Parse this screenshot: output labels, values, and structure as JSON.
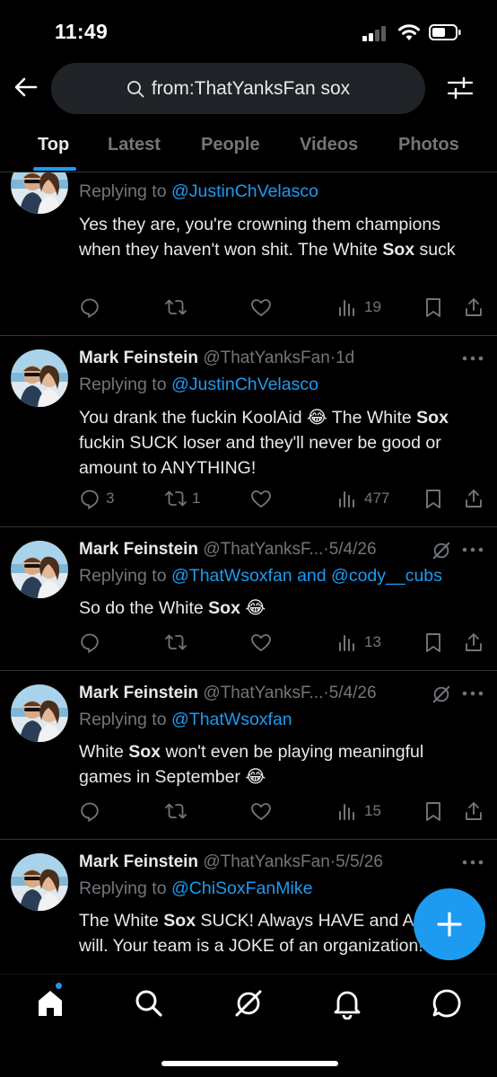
{
  "status": {
    "time": "11:49"
  },
  "search": {
    "query": "from:ThatYanksFan sox"
  },
  "tabs": [
    {
      "label": "Top",
      "active": true
    },
    {
      "label": "Latest"
    },
    {
      "label": "People"
    },
    {
      "label": "Videos"
    },
    {
      "label": "Photos"
    }
  ],
  "tweets": [
    {
      "replying_prefix": "Replying to ",
      "replying_to": "@JustinChVelasco",
      "body_parts": [
        "Yes they are, you're crowning them champions when they haven't won shit. The White ",
        "Sox",
        " suck"
      ],
      "replies": "",
      "reposts": "",
      "views": "19"
    },
    {
      "name": "Mark Feinstein",
      "handle": "@ThatYanksFan",
      "time": "·1d",
      "replying_prefix": "Replying to ",
      "replying_to": "@JustinChVelasco",
      "body_parts": [
        "You drank the fuckin KoolAid 😂 The White ",
        "Sox",
        " fuckin SUCK loser and they'll never be good or amount to ANYTHING!"
      ],
      "replies": "3",
      "reposts": "1",
      "views": "477"
    },
    {
      "name": "Mark Feinstein",
      "handle": "@ThatYanksF...",
      "time": "·5/4/26",
      "replying_prefix": "Replying to ",
      "replying_to": "@ThatWsoxfan and @cody__cubs",
      "body_parts": [
        "So do the White ",
        "Sox",
        " 😂"
      ],
      "replies": "",
      "reposts": "",
      "views": "13"
    },
    {
      "name": "Mark Feinstein",
      "handle": "@ThatYanksF...",
      "time": "·5/4/26",
      "replying_prefix": "Replying to ",
      "replying_to": "@ThatWsoxfan",
      "body_parts": [
        "White ",
        "Sox",
        " won't even be playing meaningful games in September 😂"
      ],
      "replies": "",
      "reposts": "",
      "views": "15"
    },
    {
      "name": "Mark Feinstein",
      "handle": "@ThatYanksFan",
      "time": "·5/5/26",
      "replying_prefix": "Replying to ",
      "replying_to": "@ChiSoxFanMike",
      "body_parts": [
        "The White ",
        "Sox",
        " SUCK! Always HAVE and ALWAYS will. Your team is a JOKE of an organization!"
      ]
    }
  ],
  "icons": {
    "back": "arrow-left-icon",
    "search": "search-icon",
    "filter": "sliders-icon",
    "compose": "plus-icon",
    "nav": [
      "home-icon",
      "search-icon",
      "grok-icon",
      "bell-icon",
      "chat-icon"
    ]
  },
  "colors": {
    "accent": "#1d9bf0",
    "background": "#000000",
    "muted": "#71767b",
    "text": "#e7e9ea"
  }
}
